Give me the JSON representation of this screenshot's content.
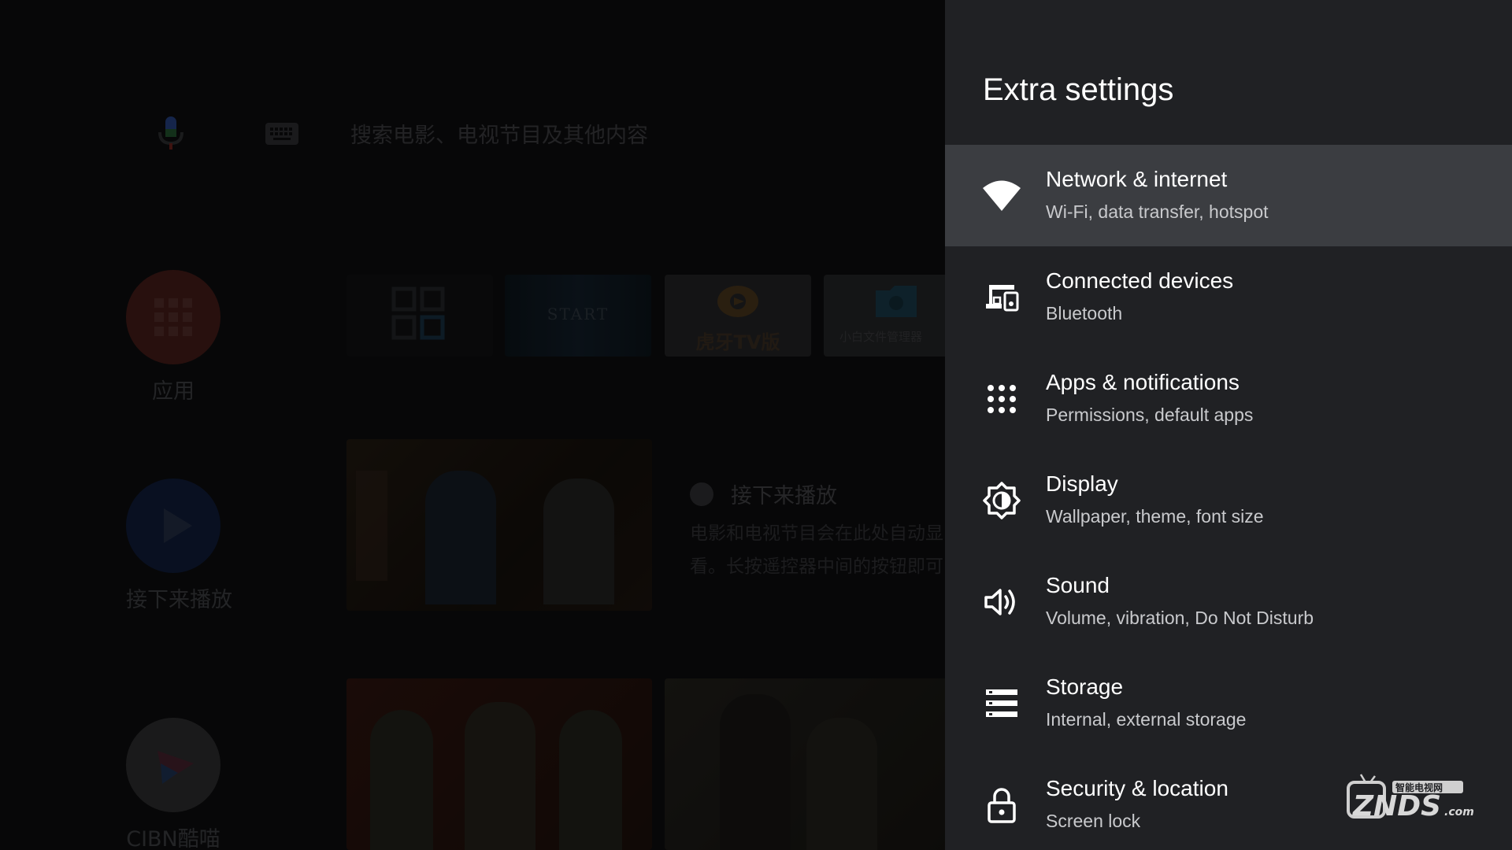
{
  "home": {
    "search_placeholder": "搜索电影、电视节目及其他内容",
    "side_apps": [
      {
        "label": "应用",
        "color": "#c6372a"
      },
      {
        "label": "接下来播放",
        "color": "#1e4fb8"
      },
      {
        "label": "CIBN酷喵",
        "color": "#e5e5e5"
      }
    ],
    "tiles": [
      {
        "label": ""
      },
      {
        "label": "START"
      },
      {
        "label": "虎牙TV版"
      },
      {
        "label": "小白文件管理器"
      }
    ],
    "play_next": {
      "title": "接下来播放",
      "desc_line1": "电影和电视节目会在此处自动显",
      "desc_line2": "看。长按遥控器中间的按钮即可"
    }
  },
  "panel": {
    "title": "Extra settings",
    "items": [
      {
        "title": "Network & internet",
        "subtitle": "Wi-Fi, data transfer, hotspot",
        "icon": "wifi-icon",
        "focused": true
      },
      {
        "title": "Connected devices",
        "subtitle": "Bluetooth",
        "icon": "devices-icon",
        "focused": false
      },
      {
        "title": "Apps & notifications",
        "subtitle": "Permissions, default apps",
        "icon": "apps-grid-icon",
        "focused": false
      },
      {
        "title": "Display",
        "subtitle": "Wallpaper, theme, font size",
        "icon": "brightness-icon",
        "focused": false
      },
      {
        "title": "Sound",
        "subtitle": "Volume, vibration, Do Not Disturb",
        "icon": "speaker-icon",
        "focused": false
      },
      {
        "title": "Storage",
        "subtitle": "Internal, external storage",
        "icon": "storage-icon",
        "focused": false
      },
      {
        "title": "Security & location",
        "subtitle": "Screen lock",
        "icon": "lock-icon",
        "focused": false
      }
    ]
  },
  "watermark": {
    "main": "ZNDS",
    "sub": "智能电视网",
    "suffix": ".com"
  },
  "colors": {
    "panel_bg": "#202124",
    "focus_bg": "#3b3d41",
    "subtitle": "#c9cacd"
  }
}
